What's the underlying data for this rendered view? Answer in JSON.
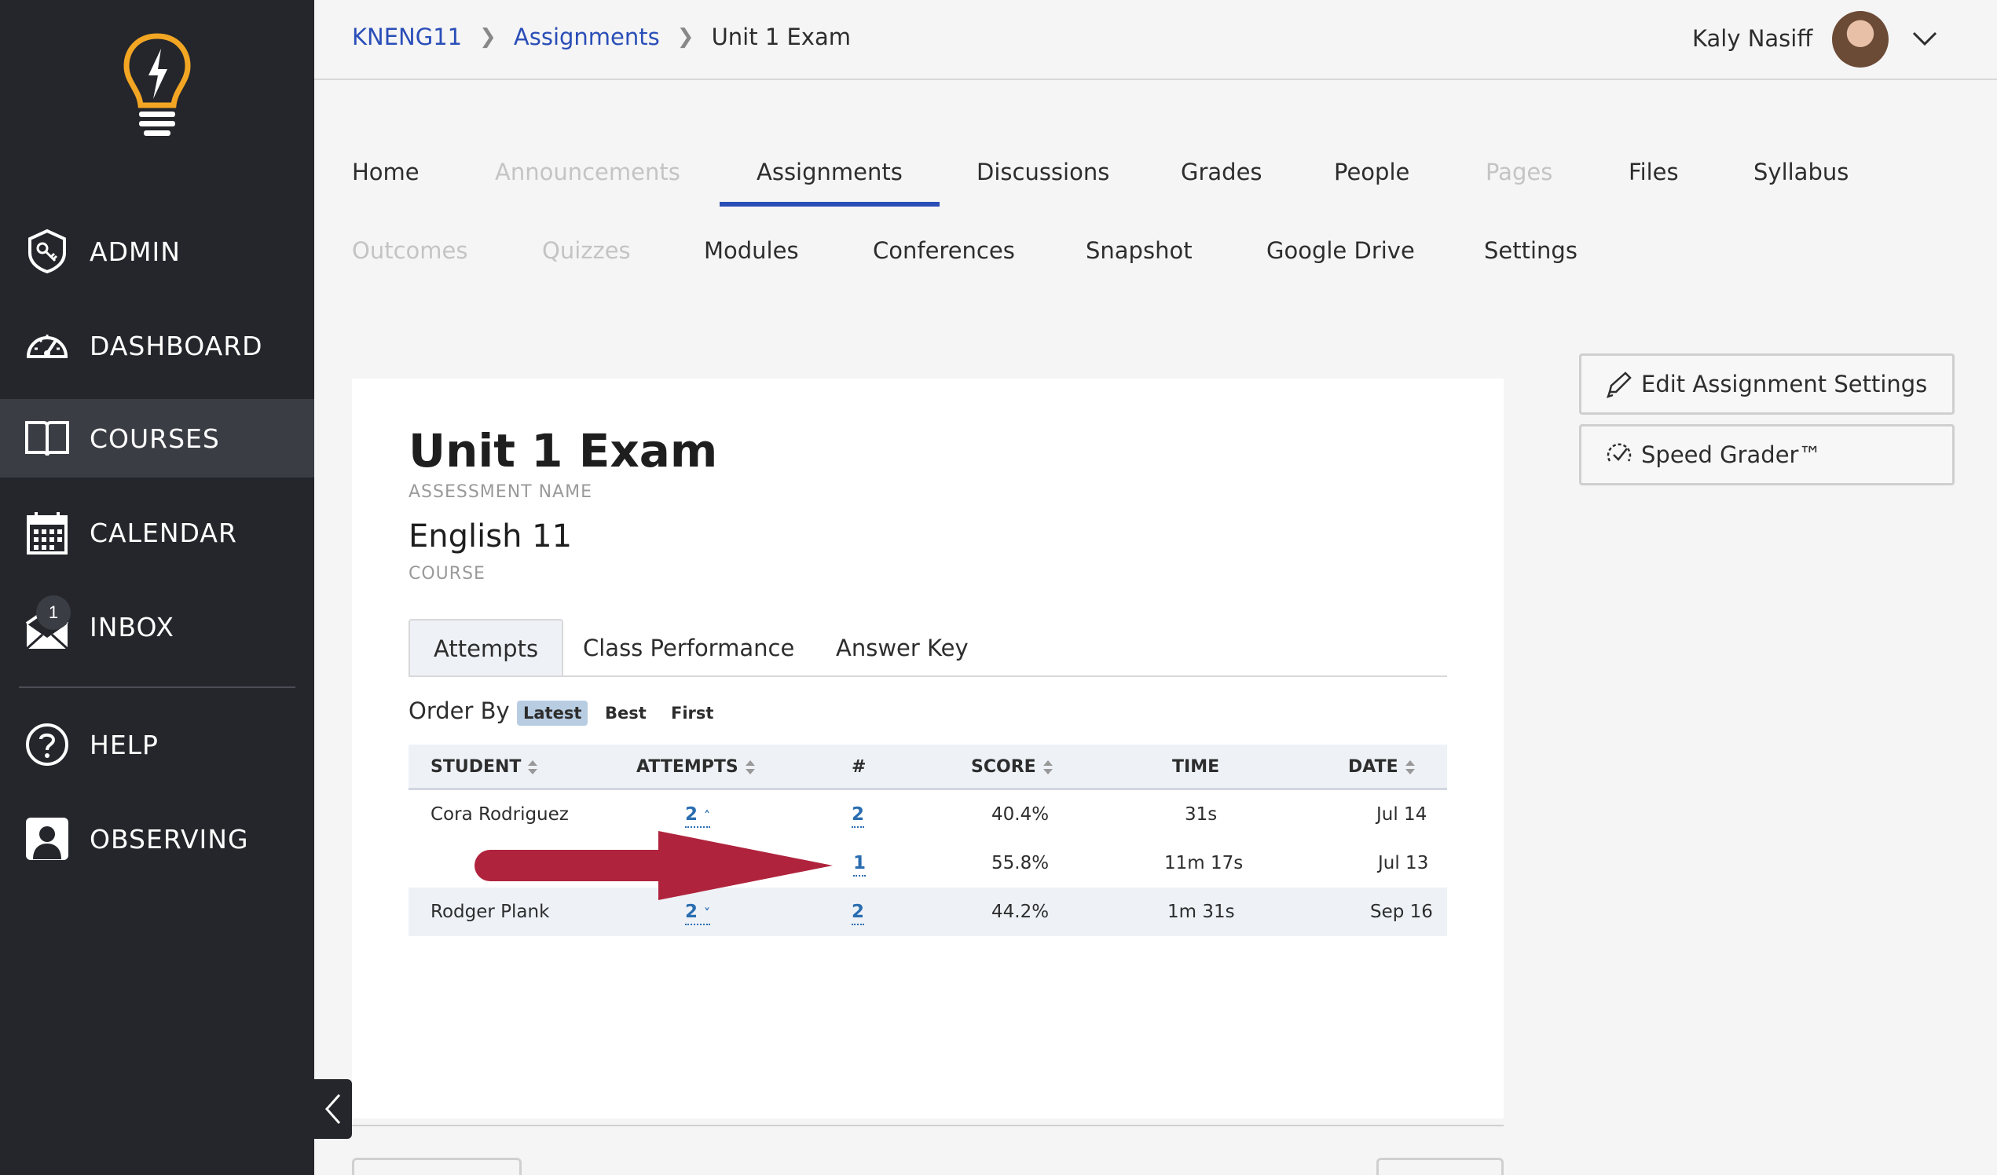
{
  "sidebar": {
    "items": [
      {
        "label": "ADMIN"
      },
      {
        "label": "DASHBOARD"
      },
      {
        "label": "COURSES"
      },
      {
        "label": "CALENDAR"
      },
      {
        "label": "INBOX",
        "badge": "1"
      },
      {
        "label": "HELP"
      },
      {
        "label": "OBSERVING"
      }
    ],
    "active": "COURSES"
  },
  "breadcrumb": {
    "items": [
      "KNENG11",
      "Assignments",
      "Unit 1 Exam"
    ]
  },
  "user": {
    "name": "Kaly Nasiff"
  },
  "course_nav": {
    "row1": [
      "Home",
      "Announcements",
      "Assignments",
      "Discussions",
      "Grades",
      "People",
      "Pages",
      "Files",
      "Syllabus"
    ],
    "row2": [
      "Outcomes",
      "Quizzes",
      "Modules",
      "Conferences",
      "Snapshot",
      "Google Drive",
      "Settings"
    ],
    "active": "Assignments",
    "disabled": [
      "Announcements",
      "Pages",
      "Outcomes",
      "Quizzes"
    ]
  },
  "assessment": {
    "title": "Unit 1 Exam",
    "title_caption": "ASSESSMENT NAME",
    "course": "English 11",
    "course_caption": "COURSE"
  },
  "tabs": [
    "Attempts",
    "Class Performance",
    "Answer Key"
  ],
  "order_by": {
    "label": "Order By",
    "options": [
      "Latest",
      "Best",
      "First"
    ],
    "active": "Latest"
  },
  "table": {
    "columns": [
      "STUDENT",
      "ATTEMPTS",
      "#",
      "SCORE",
      "TIME",
      "DATE"
    ],
    "rows": [
      {
        "student": "Cora Rodriguez",
        "attempts": "2",
        "num": "2",
        "score": "40.4%",
        "time": "31s",
        "date": "Jul 14"
      },
      {
        "student": "",
        "attempts": "",
        "num": "1",
        "score": "55.8%",
        "time": "11m 17s",
        "date": "Jul 13"
      },
      {
        "student": "Rodger Plank",
        "attempts": "2",
        "num": "2",
        "score": "44.2%",
        "time": "1m 31s",
        "date": "Sep 16"
      }
    ]
  },
  "actions": {
    "edit": "Edit Assignment Settings",
    "speed_grader": "Speed Grader™"
  },
  "colors": {
    "sidebar": "#24262b",
    "link": "#2a4eb8",
    "arrow": "#b0233d",
    "logo": "#f2a623"
  }
}
